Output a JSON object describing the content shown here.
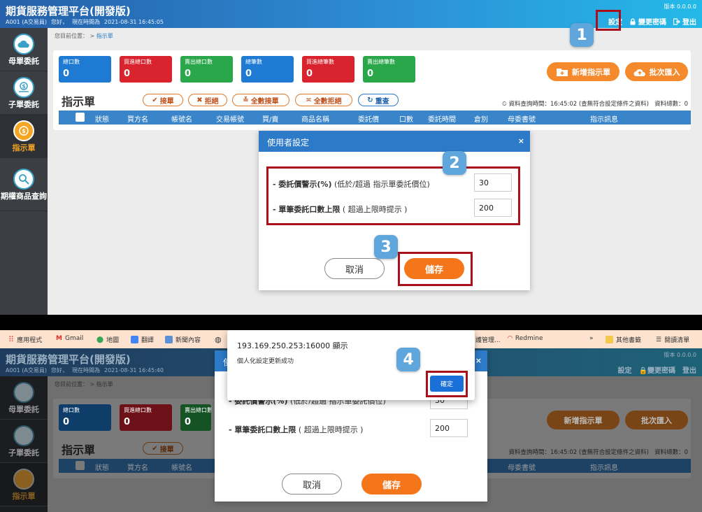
{
  "app": {
    "title": "期貨服務管理平台(開發版)",
    "account": "A001 (A交易員)",
    "greeting": "您好，",
    "time_label": "現在時間為",
    "time_top": "2021-08-31 16:45:05",
    "time_bottom": "2021-08-31 16:45:40",
    "version": "版本 0.0.0.0",
    "settings": "設定",
    "change_password": "變更密碼",
    "logout": "登出"
  },
  "sidebar": {
    "items": [
      {
        "label": "母單委託",
        "icon": "cloud-icon"
      },
      {
        "label": "子單委託",
        "icon": "money-hand-icon"
      },
      {
        "label": "指示單",
        "icon": "coin-icon"
      },
      {
        "label": "期權商品查詢",
        "icon": "search-icon"
      }
    ]
  },
  "breadcrumb": {
    "prefix": "您目前位置：",
    "sep": ">",
    "current": "指示單"
  },
  "stats": [
    {
      "label": "總口數",
      "value": "0",
      "color": "#1f7ad4"
    },
    {
      "label": "買進總口數",
      "value": "0",
      "color": "#d9232e"
    },
    {
      "label": "賣出總口數",
      "value": "0",
      "color": "#2aa74a"
    },
    {
      "label": "總筆數",
      "value": "0",
      "color": "#1f7ad4"
    },
    {
      "label": "買進總筆數",
      "value": "0",
      "color": "#d9232e"
    },
    {
      "label": "賣出總筆數",
      "value": "0",
      "color": "#2aa74a"
    }
  ],
  "actions": {
    "add": "新增指示單",
    "import": "批次匯入"
  },
  "list": {
    "title": "指示單",
    "accept": "接單",
    "reject": "拒絕",
    "accept_all": "全數接單",
    "reject_all": "全數拒絕",
    "reset": "重查",
    "query_info": "資料查詢時間：16:45:02 (查無符合設定條件之資料)",
    "total": "資料總數：0"
  },
  "table": {
    "columns": [
      "狀態",
      "買方名",
      "帳號名",
      "交易帳號",
      "買/賣",
      "商品名稱",
      "委託價",
      "口數",
      "委託時間",
      "倉別",
      "母委書號",
      "指示訊息"
    ]
  },
  "dialog": {
    "title": "使用者設定",
    "close": "×",
    "row1_label": "- 委託價警示(%)",
    "row1_hint": " (低於/超過 指示單委託價位)",
    "row1_value": "30",
    "row2_label": "- 單筆委託口數上限",
    "row2_hint": " ( 超過上限時提示 )",
    "row2_value": "200",
    "cancel": "取消",
    "save": "儲存"
  },
  "steps": [
    "1",
    "2",
    "3",
    "4"
  ],
  "bookmarks": {
    "apps": "應用程式",
    "gmail": "Gmail",
    "maps": "地圖",
    "translate": "翻譯",
    "news": "新聞內容",
    "manage": "護管理...",
    "redmine": "Redmine",
    "more": "»",
    "other": "其他書籤",
    "reading": "閱讀清單"
  },
  "alert": {
    "title": "193.169.250.253:16000 顯示",
    "message": "個人化設定更新成功",
    "ok": "確定"
  },
  "colors": {
    "accent": "#2d7ac8",
    "orange": "#f5761a",
    "highlight": "#a8111c",
    "step": "#5fa6dc"
  }
}
